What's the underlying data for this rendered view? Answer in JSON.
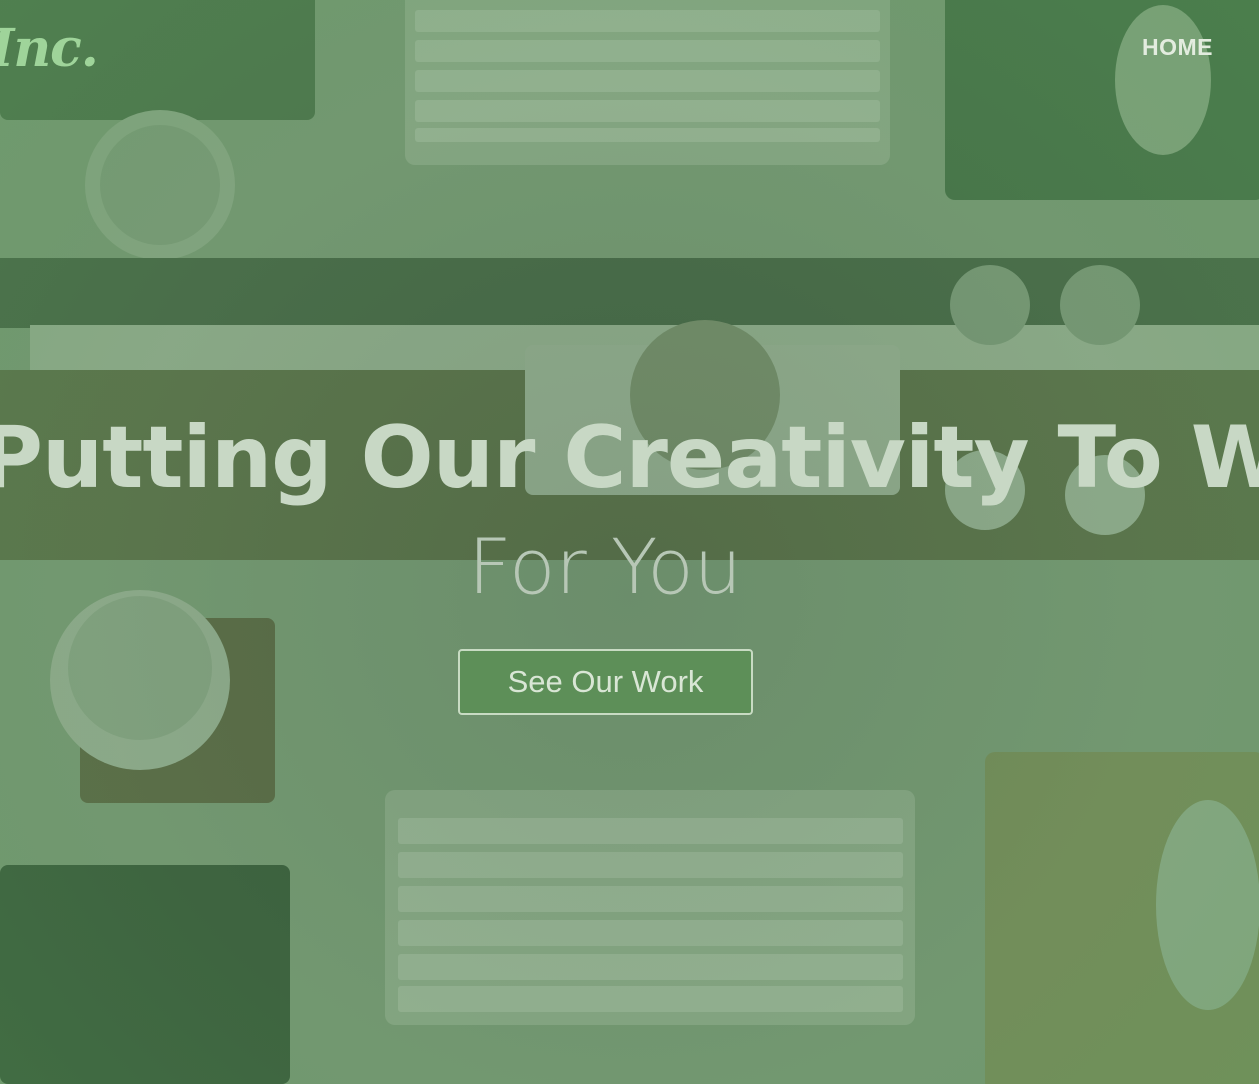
{
  "brand": {
    "logo_text": "Inc."
  },
  "nav": {
    "home_label": "HOME"
  },
  "hero": {
    "headline": "Putting Our Creativity To Work",
    "subline": "For You",
    "cta_label": "See Our Work"
  },
  "colors": {
    "overlay_green": "#5f8a62",
    "button_green": "#5d8f58",
    "logo_green": "#9fd49a"
  }
}
